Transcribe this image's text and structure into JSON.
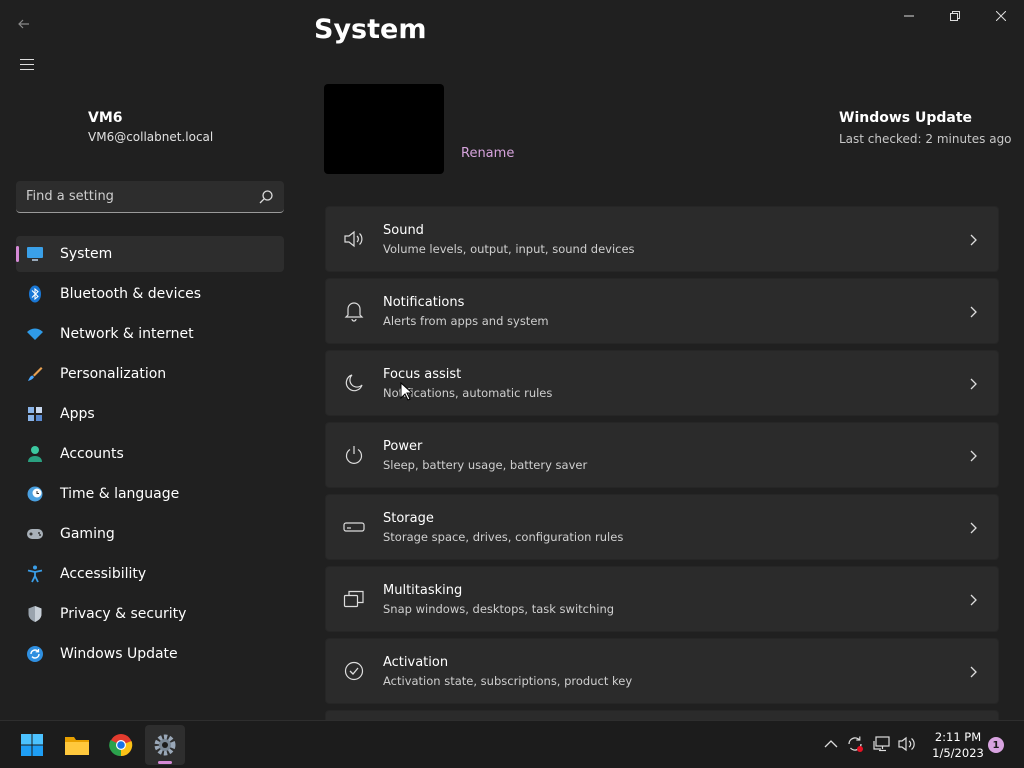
{
  "window": {
    "title": "System",
    "controls": [
      "minimize",
      "maximize",
      "close"
    ]
  },
  "profile": {
    "name": "VM6",
    "email": "VM6@collabnet.local"
  },
  "search": {
    "placeholder": "Find a setting"
  },
  "sidebar": {
    "items": [
      {
        "label": "System",
        "icon": "monitor-icon",
        "active": true
      },
      {
        "label": "Bluetooth & devices",
        "icon": "bluetooth-icon"
      },
      {
        "label": "Network & internet",
        "icon": "wifi-icon"
      },
      {
        "label": "Personalization",
        "icon": "brush-icon"
      },
      {
        "label": "Apps",
        "icon": "apps-icon"
      },
      {
        "label": "Accounts",
        "icon": "person-icon"
      },
      {
        "label": "Time & language",
        "icon": "clock-globe-icon"
      },
      {
        "label": "Gaming",
        "icon": "gamepad-icon"
      },
      {
        "label": "Accessibility",
        "icon": "accessibility-icon"
      },
      {
        "label": "Privacy & security",
        "icon": "shield-icon"
      },
      {
        "label": "Windows Update",
        "icon": "update-icon"
      }
    ]
  },
  "device": {
    "rename_label": "Rename"
  },
  "windows_update": {
    "title": "Windows Update",
    "subtitle": "Last checked: 2 minutes ago"
  },
  "cards": [
    {
      "title": "Sound",
      "subtitle": "Volume levels, output, input, sound devices",
      "icon": "speaker-icon"
    },
    {
      "title": "Notifications",
      "subtitle": "Alerts from apps and system",
      "icon": "bell-icon"
    },
    {
      "title": "Focus assist",
      "subtitle": "Notifications, automatic rules",
      "icon": "moon-icon"
    },
    {
      "title": "Power",
      "subtitle": "Sleep, battery usage, battery saver",
      "icon": "power-icon"
    },
    {
      "title": "Storage",
      "subtitle": "Storage space, drives, configuration rules",
      "icon": "storage-icon"
    },
    {
      "title": "Multitasking",
      "subtitle": "Snap windows, desktops, task switching",
      "icon": "multitasking-icon"
    },
    {
      "title": "Activation",
      "subtitle": "Activation state, subscriptions, product key",
      "icon": "check-circle-icon"
    }
  ],
  "taskbar": {
    "apps": [
      "windows-start-icon",
      "file-explorer-icon",
      "chrome-icon",
      "settings-icon"
    ],
    "tray": [
      "chevron-up-icon",
      "sync-icon",
      "network-icon",
      "volume-icon"
    ],
    "time": "2:11 PM",
    "date": "1/5/2023",
    "notification_count": "1"
  },
  "colors": {
    "background": "#202020",
    "card": "#2b2b2b",
    "accent": "#d58ad6",
    "link": "#d6a3dc"
  }
}
